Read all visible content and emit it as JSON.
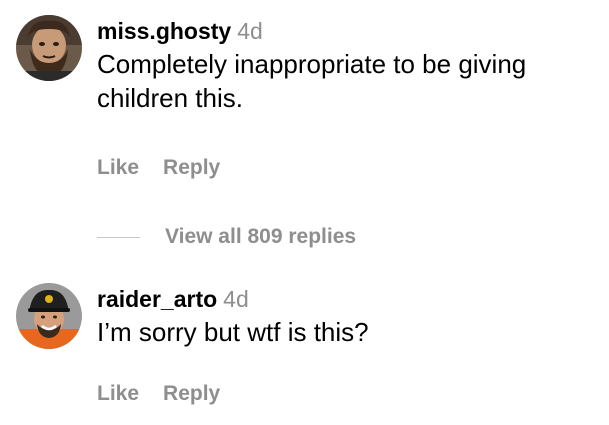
{
  "comments": [
    {
      "username": "miss.ghosty",
      "time": "4d",
      "text": "Completely inappropriate to be giving children this.",
      "like_label": "Like",
      "reply_label": "Reply",
      "avatar_icon": "bearded-man-avatar"
    },
    {
      "username": "raider_arto",
      "time": "4d",
      "text": "I’m sorry but wtf is this?",
      "like_label": "Like",
      "reply_label": "Reply",
      "avatar_icon": "smiling-man-cap-avatar"
    }
  ],
  "view_replies": {
    "label": "View all 809 replies"
  },
  "colors": {
    "text": "#000000",
    "secondary": "#8e8e8e",
    "divider": "#c7c7c7"
  }
}
